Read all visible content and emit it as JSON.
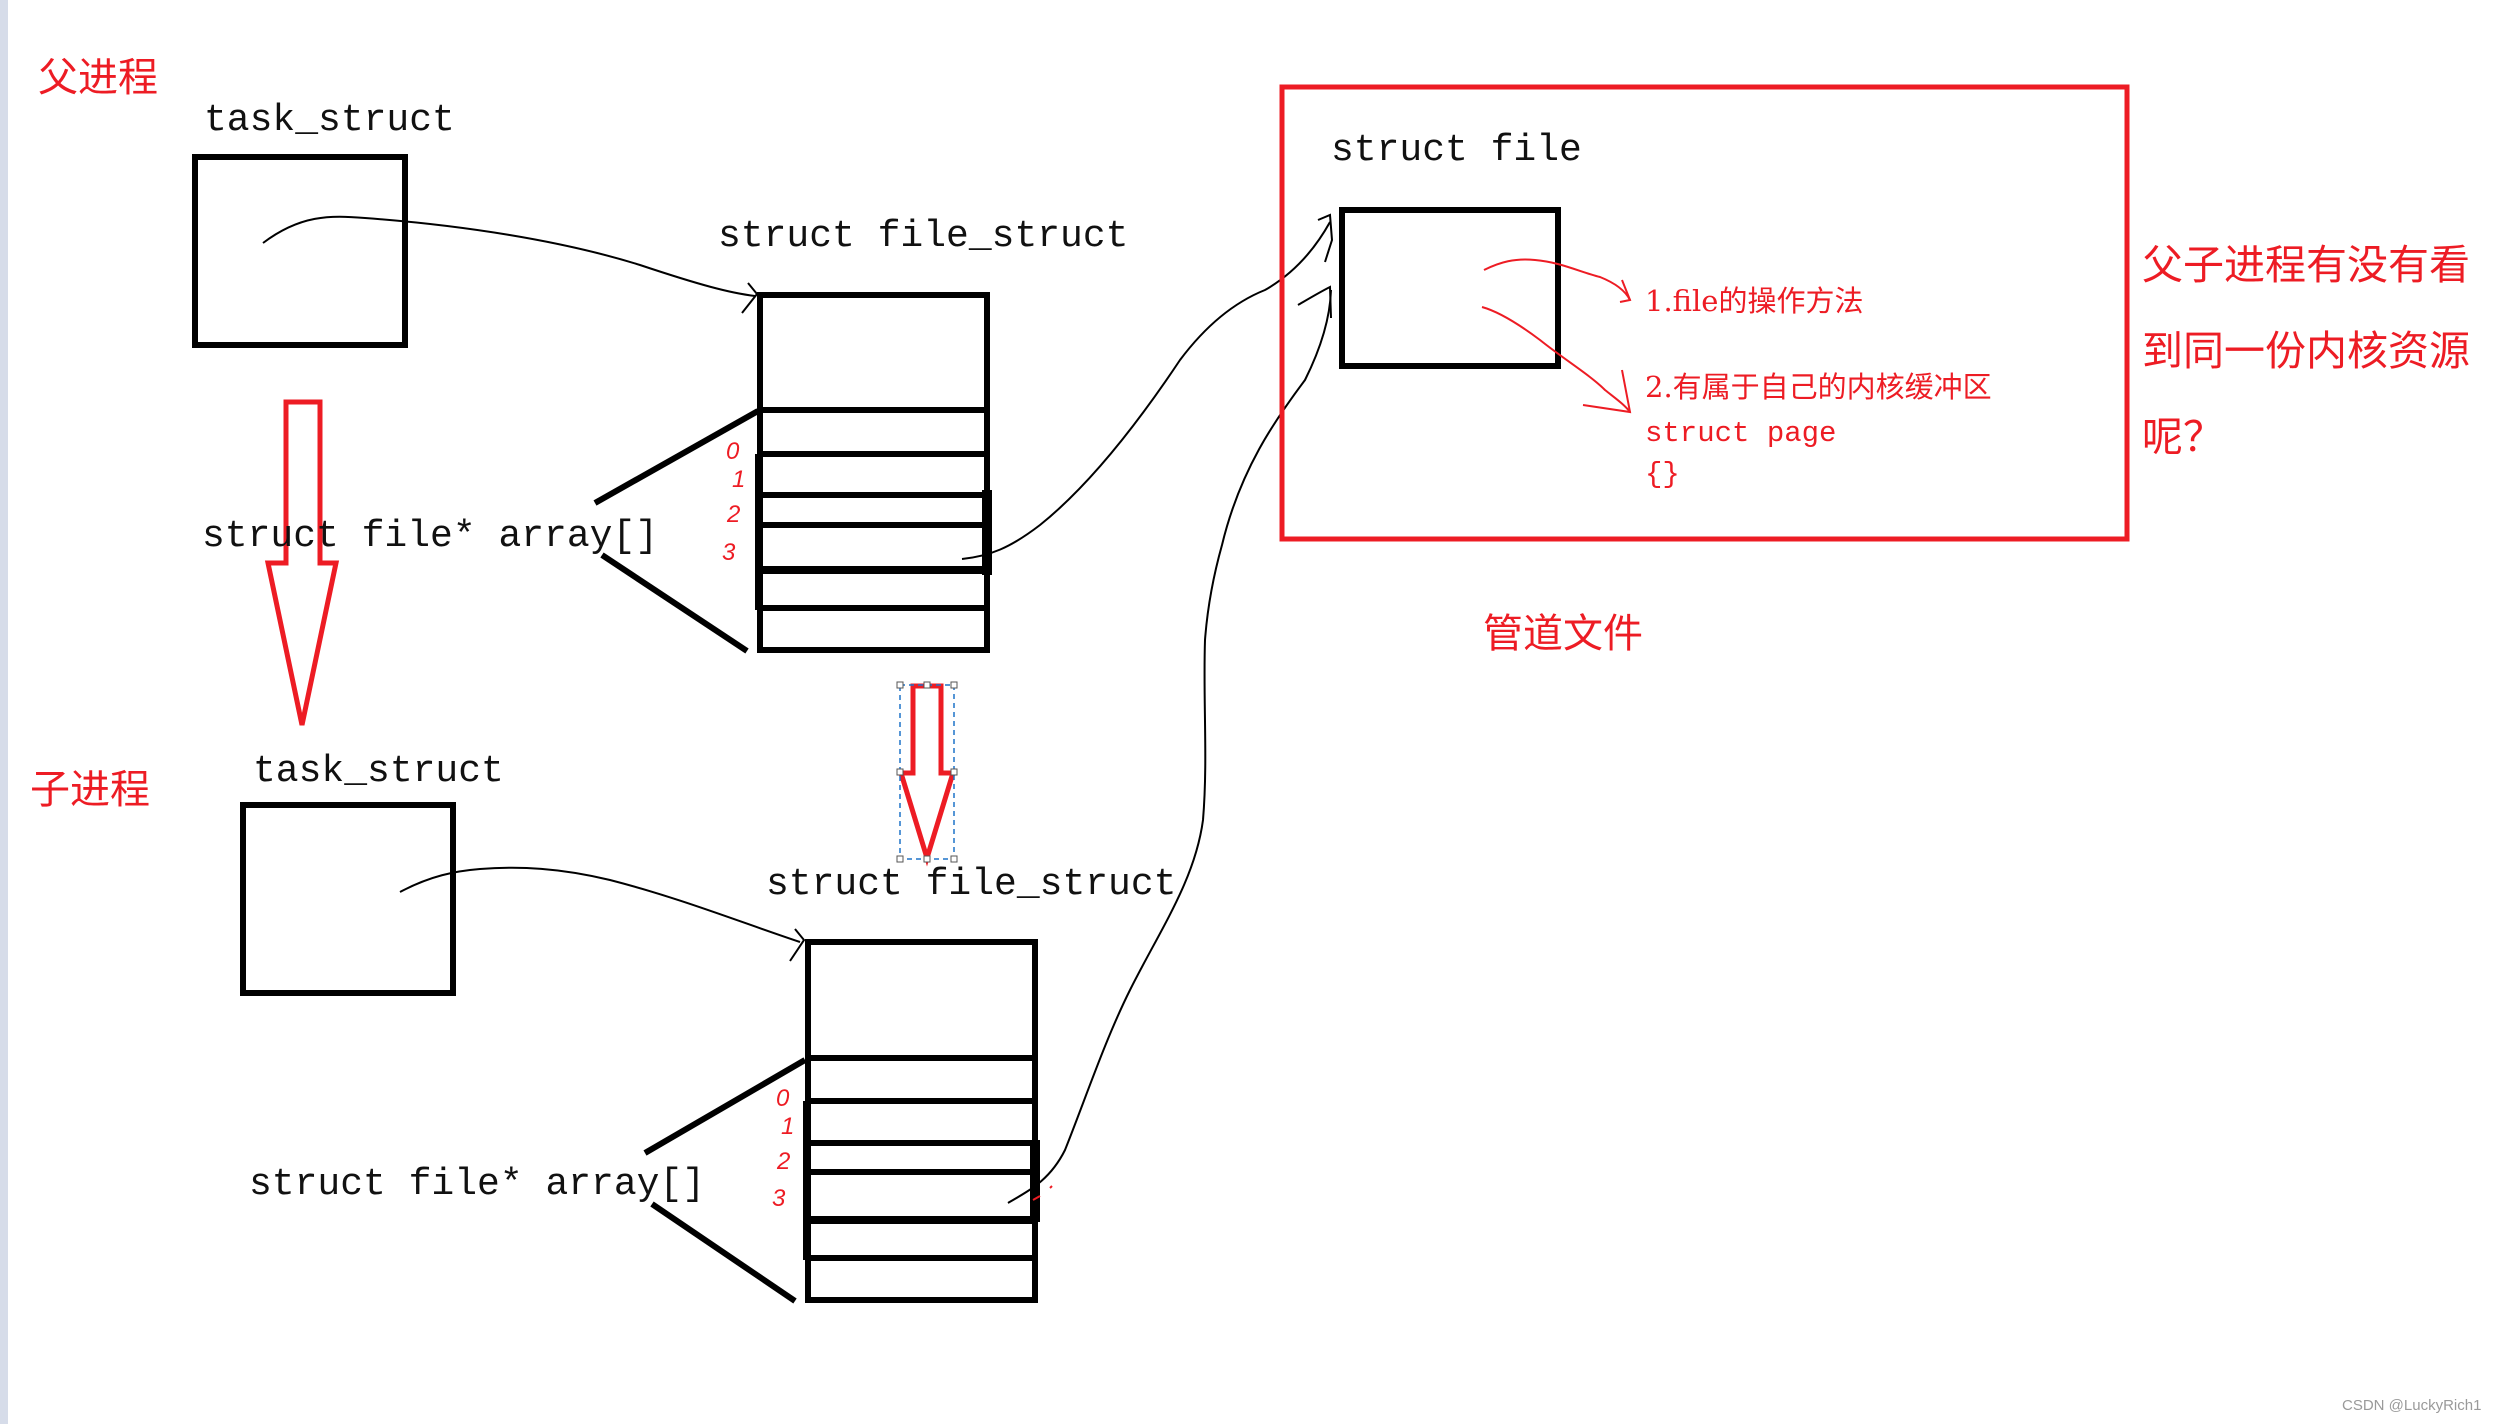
{
  "colors": {
    "accent_red": "#ed1c24",
    "ink": "#000000",
    "selection": "#1e73c8"
  },
  "parent": {
    "title": "父进程",
    "task_struct_label": "task_struct",
    "file_struct_label": "struct file_struct",
    "array_label": "struct file* array[]",
    "fd_indices": [
      "0",
      "1",
      "2",
      "3"
    ]
  },
  "child": {
    "title": "子进程",
    "task_struct_label": "task_struct",
    "file_struct_label": "struct file_struct",
    "array_label": "struct file* array[]",
    "fd_indices": [
      "0",
      "1",
      "2",
      "3"
    ]
  },
  "pipe_file": {
    "struct_label": "struct file",
    "notes": [
      "1.file的操作方法",
      "2.有属于自己的内核缓冲区"
    ],
    "page_label": "struct page",
    "page_body": "{}",
    "caption": "管道文件"
  },
  "question": "父子进程有没有看到同一份内核资源呢？",
  "watermark": "CSDN @LuckyRich1"
}
